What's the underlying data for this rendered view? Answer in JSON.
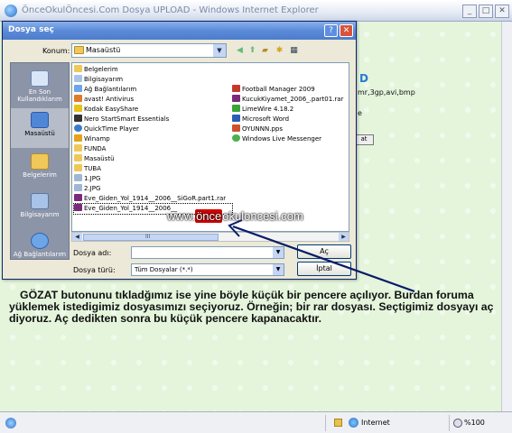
{
  "browser": {
    "title": "ÖnceOkulÖncesi.Com Dosya UPLOAD - Windows Internet Explorer",
    "status_zone": "Internet",
    "zoom": "%100",
    "page_heading_fragment": "D",
    "page_extensions_fragment": "mr,3gp,avi,bmp",
    "page_fragment_small": "e",
    "page_button_fragment": "at"
  },
  "dialog": {
    "title": "Dosya seç",
    "help_label": "?",
    "close_label": "✕",
    "lookin_label": "Konum:",
    "lookin_value": "Masaüstü",
    "places": [
      {
        "label": "En Son Kullandıklarım",
        "icon": "recent-documents-icon"
      },
      {
        "label": "Masaüstü",
        "icon": "desktop-icon"
      },
      {
        "label": "Belgelerim",
        "icon": "my-documents-icon"
      },
      {
        "label": "Bilgisayarım",
        "icon": "my-computer-icon"
      },
      {
        "label": "Ağ Bağlantılarım",
        "icon": "network-places-icon"
      }
    ],
    "files_left": [
      {
        "name": "Belgelerim",
        "icon": "folder-icon"
      },
      {
        "name": "Bilgisayarım",
        "icon": "computer-icon"
      },
      {
        "name": "Ağ Bağlantılarım",
        "icon": "network-icon"
      },
      {
        "name": "avast! Antivirus",
        "icon": "shortcut-icon"
      },
      {
        "name": "Kodak EasyShare",
        "icon": "shortcut-icon"
      },
      {
        "name": "Nero StartSmart Essentials",
        "icon": "shortcut-icon"
      },
      {
        "name": "QuickTime Player",
        "icon": "shortcut-icon"
      },
      {
        "name": "Winamp",
        "icon": "shortcut-icon"
      },
      {
        "name": "FUNDA",
        "icon": "folder-icon"
      },
      {
        "name": "Masaüstü",
        "icon": "folder-icon"
      },
      {
        "name": "TUBA",
        "icon": "folder-icon"
      },
      {
        "name": "1.JPG",
        "icon": "image-icon"
      },
      {
        "name": "2.JPG",
        "icon": "image-icon"
      },
      {
        "name": "Eve_Giden_Yol_1914__2006__SiGoR.part1.rar",
        "icon": "rar-icon"
      },
      {
        "name": "Eve_Giden_Yol_1914__2006__",
        "icon": "rar-icon"
      }
    ],
    "files_right": [
      {
        "name": "Football Manager 2009",
        "icon": "shortcut-icon"
      },
      {
        "name": "KucukKiyamet_2006_.part01.rar",
        "icon": "rar-icon"
      },
      {
        "name": "LimeWire 4.18.2",
        "icon": "shortcut-icon"
      },
      {
        "name": "Microsoft Word",
        "icon": "word-icon"
      },
      {
        "name": "OYUNNN.pps",
        "icon": "pps-icon"
      },
      {
        "name": "Windows Live Messenger",
        "icon": "messenger-icon"
      }
    ],
    "filename_label": "Dosya adı:",
    "filename_value": "",
    "filetype_label": "Dosya türü:",
    "filetype_value": "Tüm Dosyalar (*.*)",
    "open_label": "Aç",
    "cancel_label": "İptal",
    "scroll_thumb_glyph": "III"
  },
  "watermark": {
    "pre": "www.",
    "highlight": "önce",
    "post": "okuloncesi.com"
  },
  "caption": "GÖZAT butonunu tıkladğımız ise yine böyle küçük bir pencere açılıyor. Burdan foruma yüklemek istedigimiz dosyasımızı seçiyoruz. Örneğin; bir rar dosyası. Seçtigimiz dosyayı aç diyoruz. Aç dedikten sonra bu küçük pencere kapanacaktır.",
  "colors": {
    "dialog_title": "#4c7ccc",
    "page_bg": "#e4f5dc",
    "places_bar": "#8c94a8",
    "arrow": "#0a1b66"
  }
}
